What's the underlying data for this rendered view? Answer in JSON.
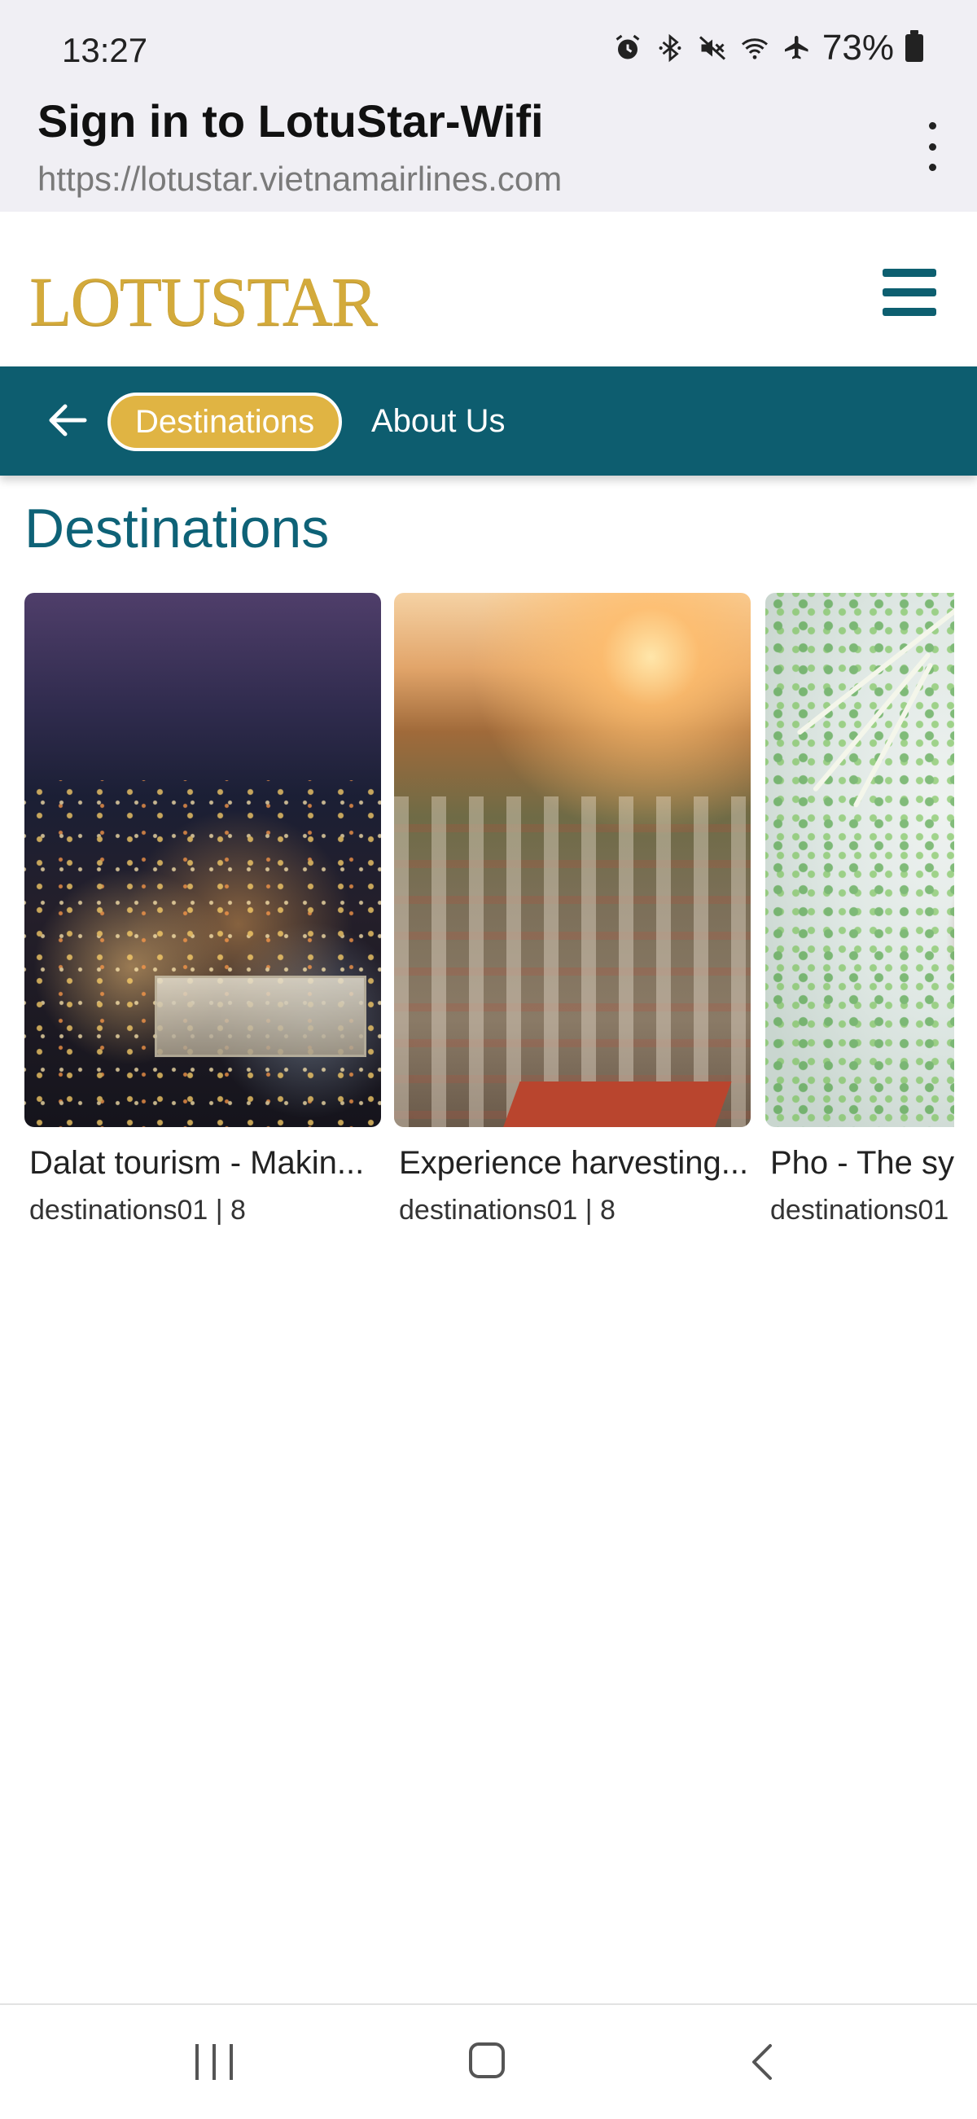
{
  "status_bar": {
    "time": "13:27",
    "battery": "73%",
    "icons": [
      "alarm-icon",
      "bluetooth-icon",
      "mute-icon",
      "wifi-icon",
      "airplane-icon",
      "battery-icon"
    ]
  },
  "browser": {
    "title": "Sign in to LotuStar-Wifi",
    "url": "https://lotustar.vietnamairlines.com"
  },
  "header": {
    "logo_text": "LOTUSTAR"
  },
  "nav": {
    "active": "Destinations",
    "link": "About Us"
  },
  "page": {
    "title": "Destinations"
  },
  "cards": [
    {
      "title": "Dalat tourism - Makin...",
      "meta": "destinations01 | 8"
    },
    {
      "title": "Experience harvesting...",
      "meta": "destinations01 | 8"
    },
    {
      "title": "Pho - The sy",
      "meta": "destinations01"
    }
  ],
  "colors": {
    "brand_teal": "#0d5d6f",
    "accent_gold": "#e0b443",
    "title_teal": "#0e6277"
  }
}
